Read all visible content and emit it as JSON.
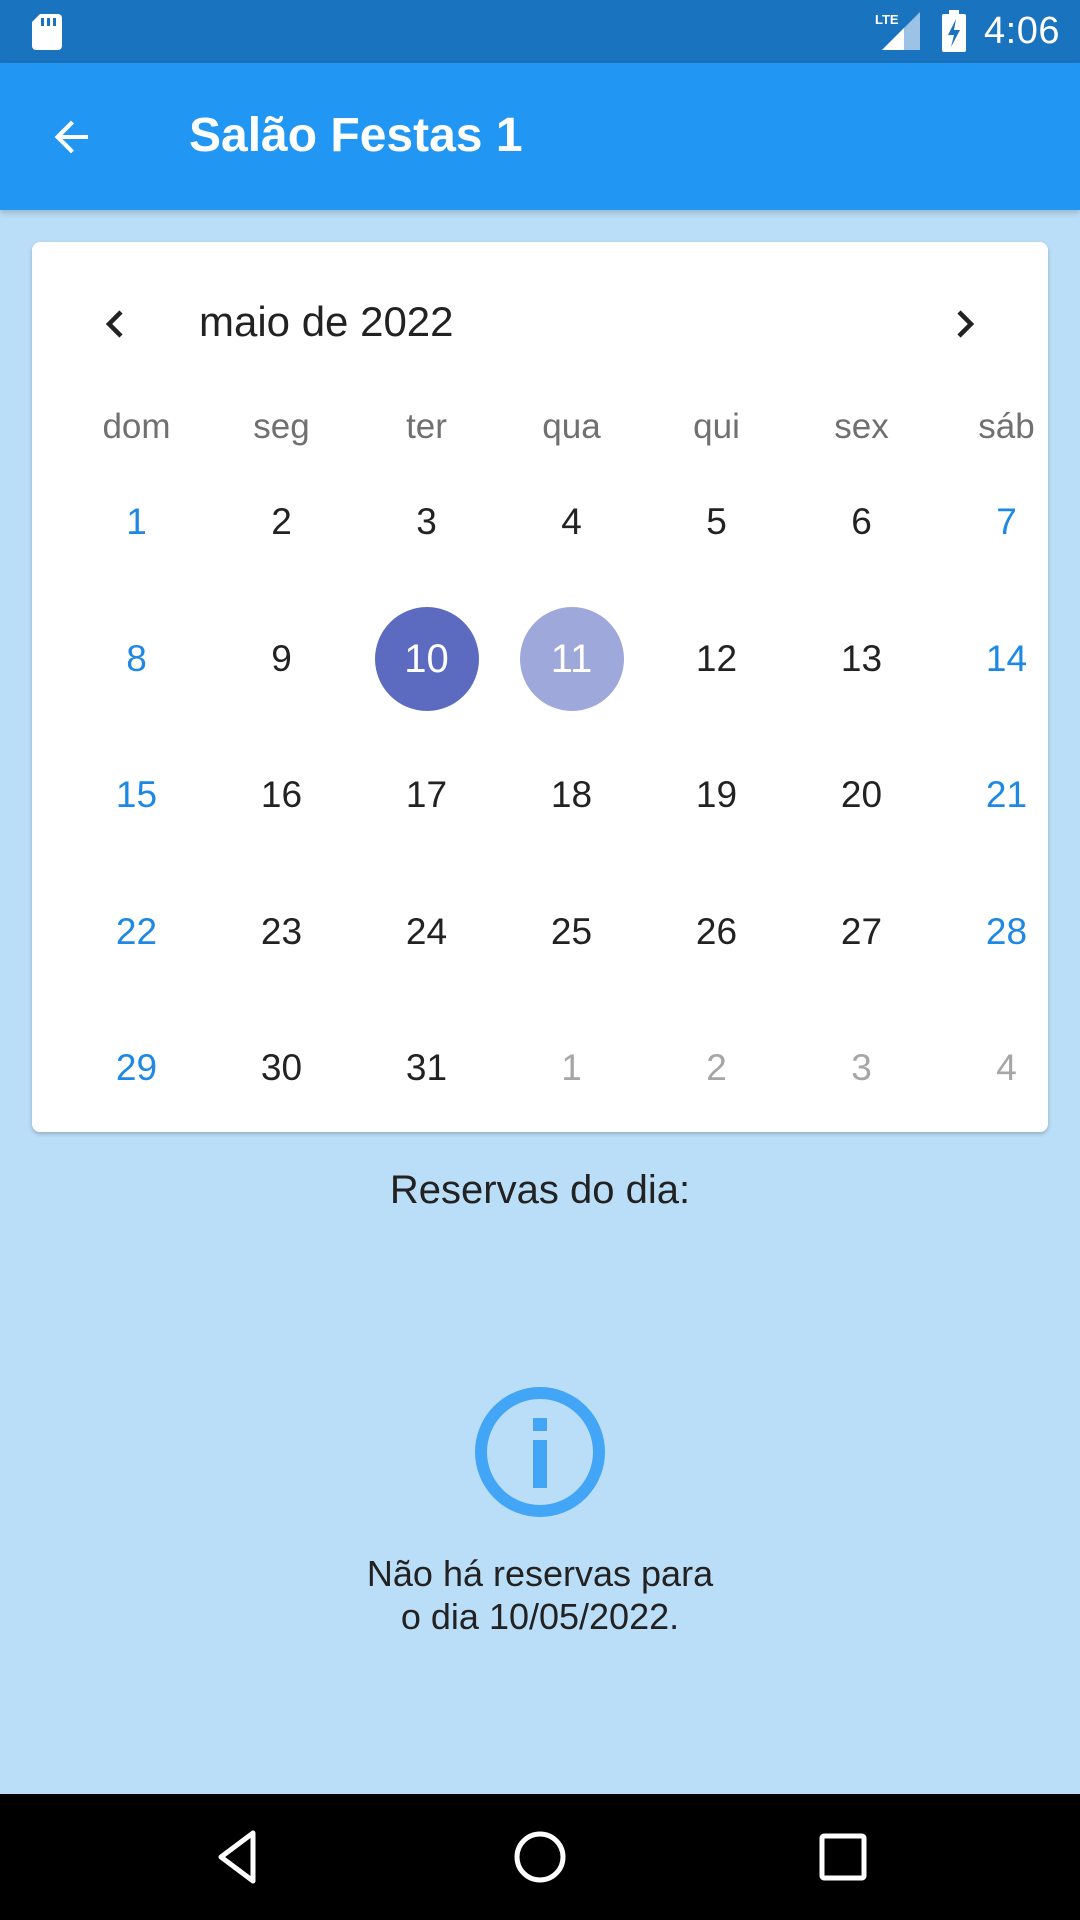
{
  "status_bar": {
    "time": "4:06",
    "icons": [
      "sd-card-icon",
      "lte-signal-icon",
      "battery-charging-icon"
    ]
  },
  "app_bar": {
    "title": "Salão Festas 1",
    "back_icon": "arrow-back-icon"
  },
  "calendar": {
    "month_title": "maio de 2022",
    "prev_icon": "chevron-left-icon",
    "next_icon": "chevron-right-icon",
    "weekdays": [
      "dom",
      "seg",
      "ter",
      "qua",
      "qui",
      "sex",
      "sáb"
    ],
    "weeks": [
      [
        "1",
        "2",
        "3",
        "4",
        "5",
        "6",
        "7"
      ],
      [
        "8",
        "9",
        "10",
        "11",
        "12",
        "13",
        "14"
      ],
      [
        "15",
        "16",
        "17",
        "18",
        "19",
        "20",
        "21"
      ],
      [
        "22",
        "23",
        "24",
        "25",
        "26",
        "27",
        "28"
      ],
      [
        "29",
        "30",
        "31",
        "1",
        "2",
        "3",
        "4"
      ]
    ],
    "selected_day": "10",
    "today_day": "11",
    "outside_month_days_in_last_week": [
      "1",
      "2",
      "3",
      "4"
    ],
    "colors": {
      "weekend": "#1E88E5",
      "selected": "#5C6BC0",
      "today": "#9FA8DA",
      "outside": "#A6A6A6"
    }
  },
  "reservations": {
    "title": "Reservas do dia:",
    "empty_icon": "info-icon",
    "empty_message": "Não há reservas para\no dia 10/05/2022."
  },
  "nav_bar": {
    "buttons": [
      "back-triangle-icon",
      "home-circle-icon",
      "recents-square-icon"
    ]
  },
  "colors": {
    "status_bar": "#1A73BE",
    "app_bar": "#2196F3",
    "background": "#BBDEF8",
    "info_icon": "#42A5F5"
  }
}
